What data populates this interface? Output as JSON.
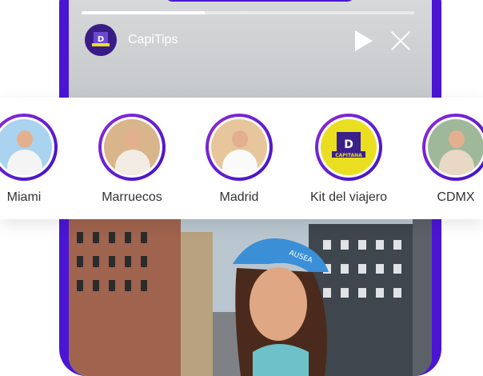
{
  "story": {
    "channel_name": "CapiTips",
    "brand_label": "CAPITANA",
    "progress": 0.37,
    "photo_cap_text": "AUSEA"
  },
  "stories": [
    {
      "label": "Miami",
      "kind": "photo",
      "sky": "#a9d3ee",
      "shirt": "#f4f4f4"
    },
    {
      "label": "Marruecos",
      "kind": "photo",
      "sky": "#d9b58c",
      "shirt": "#f2ece5"
    },
    {
      "label": "Madrid",
      "kind": "photo",
      "sky": "#e6c69a",
      "shirt": "#fafafa"
    },
    {
      "label": "Kit del viajero",
      "kind": "logo",
      "sky": "#e9df20",
      "shirt": "#3b1f8a"
    },
    {
      "label": "CDMX",
      "kind": "photo",
      "sky": "#9fb89a",
      "shirt": "#e9d9c4"
    }
  ],
  "colors": {
    "accent": "#4a16d4",
    "ring_start": "#8e2bd8",
    "ring_end": "#3c13c8",
    "logo_yellow": "#e9df20"
  }
}
